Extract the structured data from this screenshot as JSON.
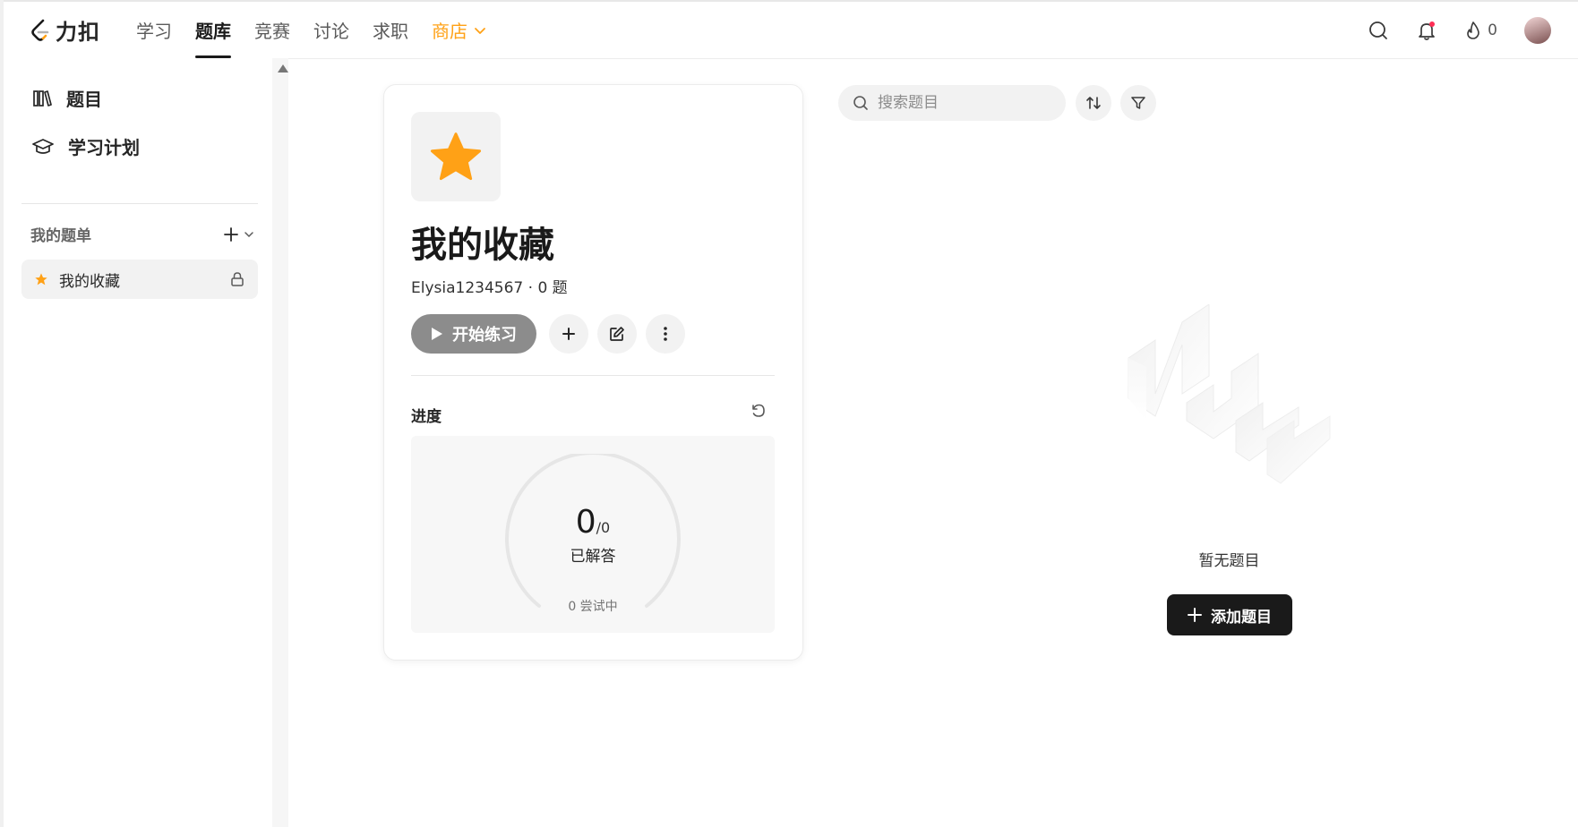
{
  "header": {
    "logo_text": "力扣",
    "nav": [
      {
        "label": "学习"
      },
      {
        "label": "题库"
      },
      {
        "label": "竞赛"
      },
      {
        "label": "讨论"
      },
      {
        "label": "求职"
      },
      {
        "label": "商店"
      }
    ],
    "active_nav": "题库",
    "streak_count": "0",
    "store_color": "#ffa116",
    "notification_dot_color": "#ff2d55"
  },
  "sidebar": {
    "items": [
      {
        "label": "题目",
        "icon": "library-icon"
      },
      {
        "label": "学习计划",
        "icon": "graduation-cap-icon"
      }
    ],
    "lists_heading": "我的题单",
    "favorite_list": {
      "label": "我的收藏",
      "icon": "star-icon",
      "locked": true
    }
  },
  "card": {
    "title": "我的收藏",
    "meta": "Elysia1234567 · 0 题",
    "start_label": "开始练习",
    "progress_label": "进度",
    "solved": "0",
    "total": "/0",
    "solved_label": "已解答",
    "attempting": "0 尝试中",
    "accent_color": "#ffa116"
  },
  "toolbar": {
    "search_placeholder": "搜索题目"
  },
  "empty": {
    "text": "暂无题目",
    "add_label": "添加题目"
  }
}
